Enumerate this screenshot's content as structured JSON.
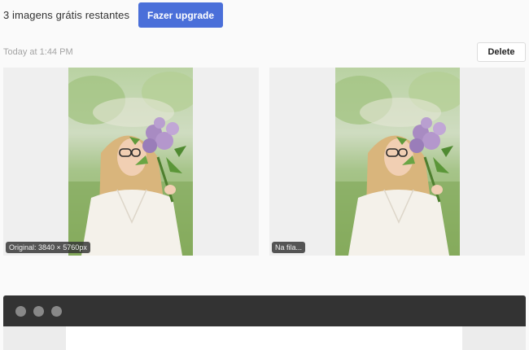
{
  "header": {
    "credits_text": "3 imagens grátis restantes",
    "upgrade_label": "Fazer upgrade"
  },
  "item": {
    "timestamp": "Today at 1:44 PM",
    "delete_label": "Delete",
    "original": {
      "badge": "Original: 3840 × 5760px"
    },
    "processed": {
      "badge": "Na fila..."
    }
  },
  "colors": {
    "accent": "#4a6fd9",
    "page_background": "#fafafa",
    "window_bar": "#333333"
  },
  "icons": {
    "window_controls": [
      "window-dot-icon",
      "window-dot-icon",
      "window-dot-icon"
    ]
  }
}
